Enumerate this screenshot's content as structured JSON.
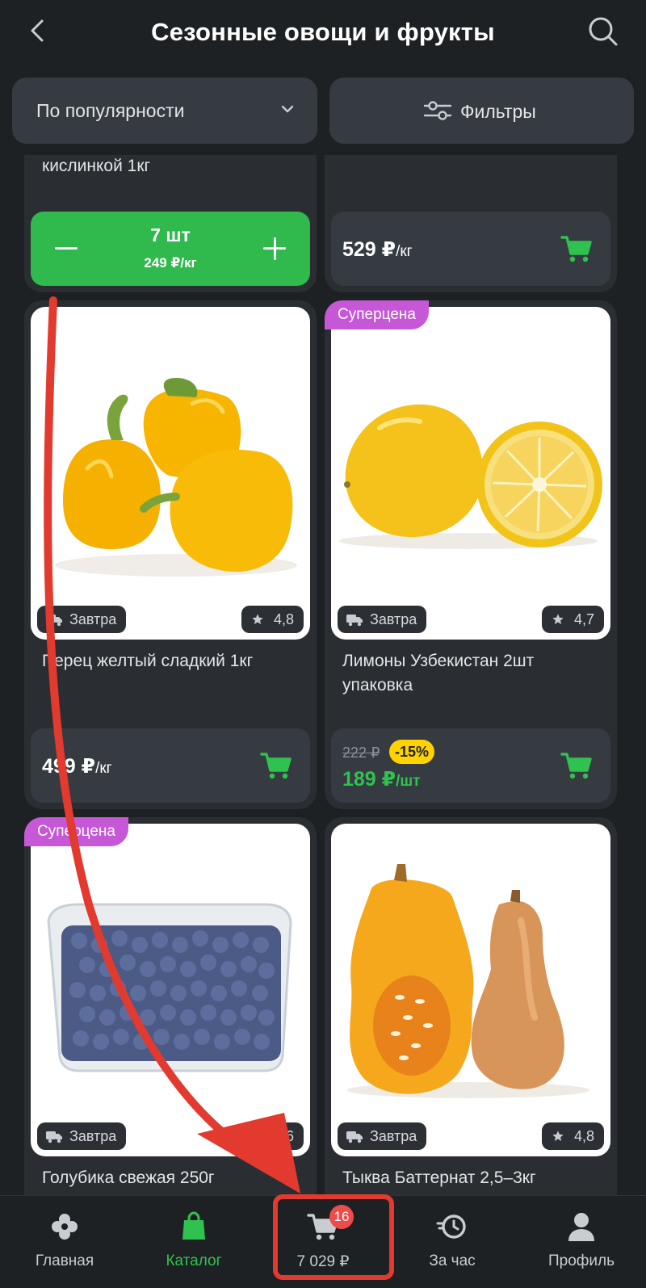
{
  "header": {
    "title": "Сезонные овощи и фрукты"
  },
  "filters": {
    "sort_label": "По популярности",
    "filter_label": "Фильтры"
  },
  "top_cards": [
    {
      "name_tail": "кислинкой 1кг",
      "qty": "7 шт",
      "unit_price": "249 ₽/кг"
    },
    {
      "price": "529 ₽",
      "price_unit": "/кг"
    }
  ],
  "products": [
    {
      "name": "Перец желтый сладкий 1кг",
      "delivery": "Завтра",
      "rating": "4,8",
      "price": "499 ₽",
      "price_unit": "/кг"
    },
    {
      "name": "Лимоны Узбекистан 2шт упаковка",
      "delivery": "Завтра",
      "rating": "4,7",
      "promo": "Суперцена",
      "old_price": "222 ₽",
      "discount": "-15%",
      "price": "189 ₽",
      "price_unit": "/шт"
    },
    {
      "name": "Голубика свежая 250г",
      "delivery": "Завтра",
      "rating": "4,6",
      "promo": "Суперцена"
    },
    {
      "name": "Тыква Баттернат 2,5–3кг",
      "delivery": "Завтра",
      "rating": "4,8"
    }
  ],
  "tabs": [
    {
      "label": "Главная",
      "icon": "clover-icon"
    },
    {
      "label": "Каталог",
      "icon": "shopping-bag-icon"
    },
    {
      "label": "7 029 ₽",
      "icon": "cart-icon",
      "badge": "16"
    },
    {
      "label": "За час",
      "icon": "clock-icon"
    },
    {
      "label": "Профиль",
      "icon": "profile-icon"
    }
  ],
  "colors": {
    "background": "#1e2124",
    "card": "#2a2e33",
    "accent_green": "#30b94d",
    "promo_purple": "#c658d8",
    "annotation_red": "#e23a2e"
  }
}
